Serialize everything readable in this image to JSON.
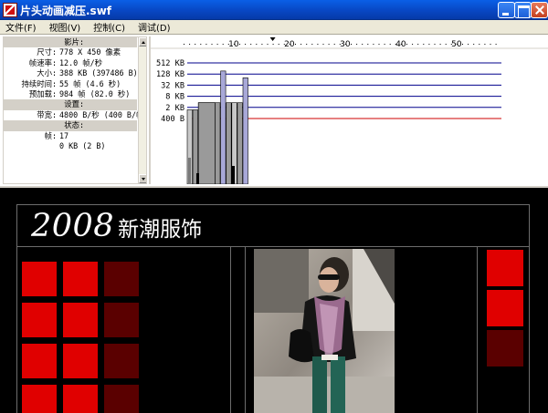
{
  "window": {
    "title": "片头动画减压.swf"
  },
  "menu": {
    "items": [
      "文件(F)",
      "视图(V)",
      "控制(C)",
      "调试(D)"
    ]
  },
  "info": {
    "rows": [
      {
        "key": "影片:",
        "value": "",
        "section": true
      },
      {
        "key": "尺寸:",
        "value": "778 X 450 像素"
      },
      {
        "key": "帧速率:",
        "value": "12.0 帧/秒"
      },
      {
        "key": "大小:",
        "value": "388 KB (397486 B)"
      },
      {
        "key": "持续时间:",
        "value": "55 帧 (4.6 秒)"
      },
      {
        "key": "预加载:",
        "value": "984 帧 (82.0 秒)"
      },
      {
        "key": "设置:",
        "value": "",
        "section": true
      },
      {
        "key": "带宽:",
        "value": "4800 B/秒 (400 B/帧)"
      },
      {
        "key": "状态:",
        "value": "",
        "section": true
      },
      {
        "key": "帧:",
        "value": "17"
      },
      {
        "key": "",
        "value": "0 KB (2 B)"
      }
    ]
  },
  "profiler": {
    "timeline_ticks": [
      "10",
      "20",
      "30",
      "40",
      "50"
    ],
    "y_labels": [
      "512 KB",
      "128 KB",
      "32 KB",
      "8 KB",
      "2 KB",
      "400 B"
    ],
    "colors": {
      "kb_line": "#00008b",
      "bandwidth_line": "#cc0000",
      "bar_light": "#c8c8c8",
      "bar_mid": "#9a9a9a",
      "bar_dark": "#7a7a7a",
      "bar_outline": "#000000",
      "tall_bar_fill": "#a8a8d8"
    },
    "chart_data": {
      "type": "bar",
      "xlabel": "",
      "ylabel": "",
      "x_ticks": [
        10,
        20,
        30,
        40,
        50
      ],
      "y_ticks": [
        "400 B",
        "2 KB",
        "8 KB",
        "32 KB",
        "128 KB",
        "512 KB"
      ],
      "bandwidth_limit": "400 B",
      "series": [
        {
          "frames": [
            1,
            2,
            3,
            4,
            5,
            6,
            7,
            8,
            9,
            10,
            11
          ],
          "values_kb": [
            1.2,
            1.2,
            3.0,
            3.0,
            3.0,
            3.0,
            180,
            3.0,
            3.0,
            3.0,
            75
          ]
        }
      ]
    }
  },
  "movie": {
    "headline_year": "2008",
    "headline_text": "新潮服饰",
    "colors": {
      "tile_bright": "#e00000",
      "tile_dark": "#5a0000"
    }
  }
}
